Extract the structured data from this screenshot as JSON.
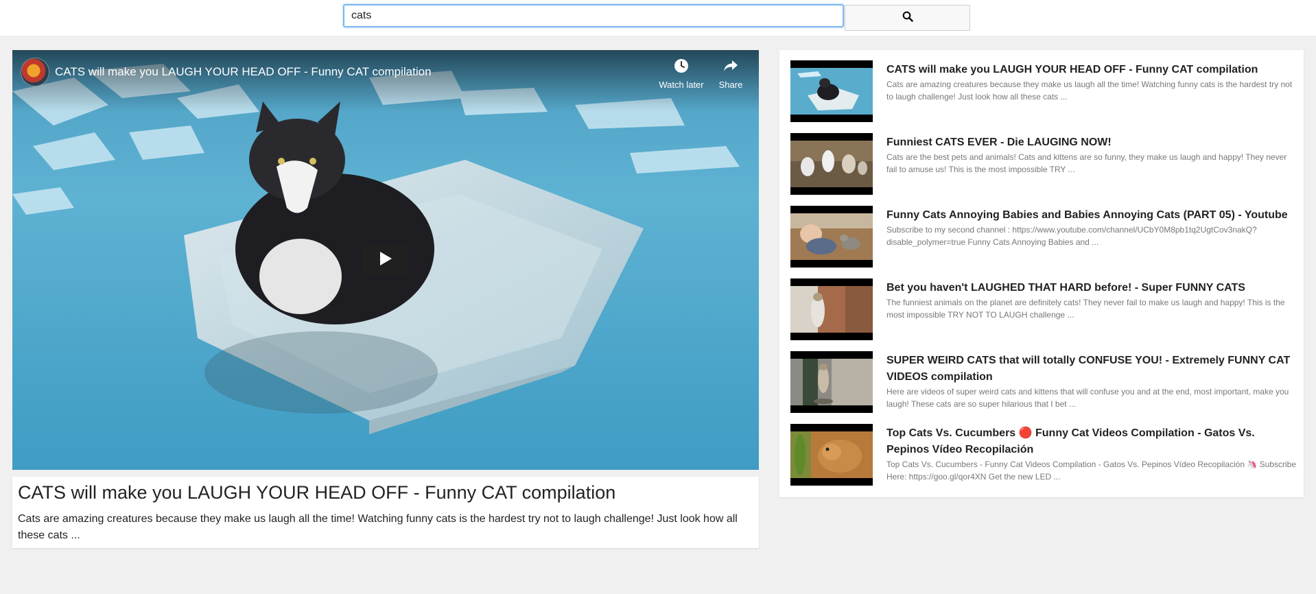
{
  "search": {
    "query": "cats",
    "icon": "search-icon"
  },
  "player": {
    "title": "CATS will make you LAUGH YOUR HEAD OFF - Funny CAT compilation",
    "watch_later_label": "Watch later",
    "share_label": "Share"
  },
  "selected": {
    "title": "CATS will make you LAUGH YOUR HEAD OFF - Funny CAT compilation",
    "description": "Cats are amazing creatures because they make us laugh all the time! Watching funny cats is the hardest try not to laugh challenge! Just look how all these cats ..."
  },
  "videos": [
    {
      "title": "CATS will make you LAUGH YOUR HEAD OFF - Funny CAT compilation",
      "description": "Cats are amazing creatures because they make us laugh all the time! Watching funny cats is the hardest try not to laugh challenge! Just look how all these cats ..."
    },
    {
      "title": "Funniest CATS EVER - Die LAUGING NOW!",
      "description": "Cats are the best pets and animals! Cats and kittens are so funny, they make us laugh and happy! They never fail to amuse us! This is the most impossible TRY ..."
    },
    {
      "title": "Funny Cats Annoying Babies and Babies Annoying Cats (PART 05) - Youtube",
      "description": "Subscribe to my second channel : https://www.youtube.com/channel/UCbY0M8pb1tq2UgtCov3nakQ?disable_polymer=true Funny Cats Annoying Babies and ..."
    },
    {
      "title": "Bet you haven't LAUGHED THAT HARD before! - Super FUNNY CATS",
      "description": "The funniest animals on the planet are definitely cats! They never fail to make us laugh and happy! This is the most impossible TRY NOT TO LAUGH challenge ..."
    },
    {
      "title": "SUPER WEIRD CATS that will totally CONFUSE YOU! - Extremely FUNNY CAT VIDEOS compilation",
      "description": "Here are videos of super weird cats and kittens that will confuse you and at the end, most important, make you laugh! These cats are so super hilarious that I bet ..."
    },
    {
      "title": "Top Cats Vs. Cucumbers 🔴 Funny Cat Videos Compilation - Gatos Vs. Pepinos Vídeo Recopilación",
      "description": "Top Cats Vs. Cucumbers - Funny Cat Videos Compilation - Gatos Vs. Pepinos Vídeo Recopilación 🦄 Subscribe Here: https://goo.gl/qor4XN Get the new LED ..."
    }
  ]
}
